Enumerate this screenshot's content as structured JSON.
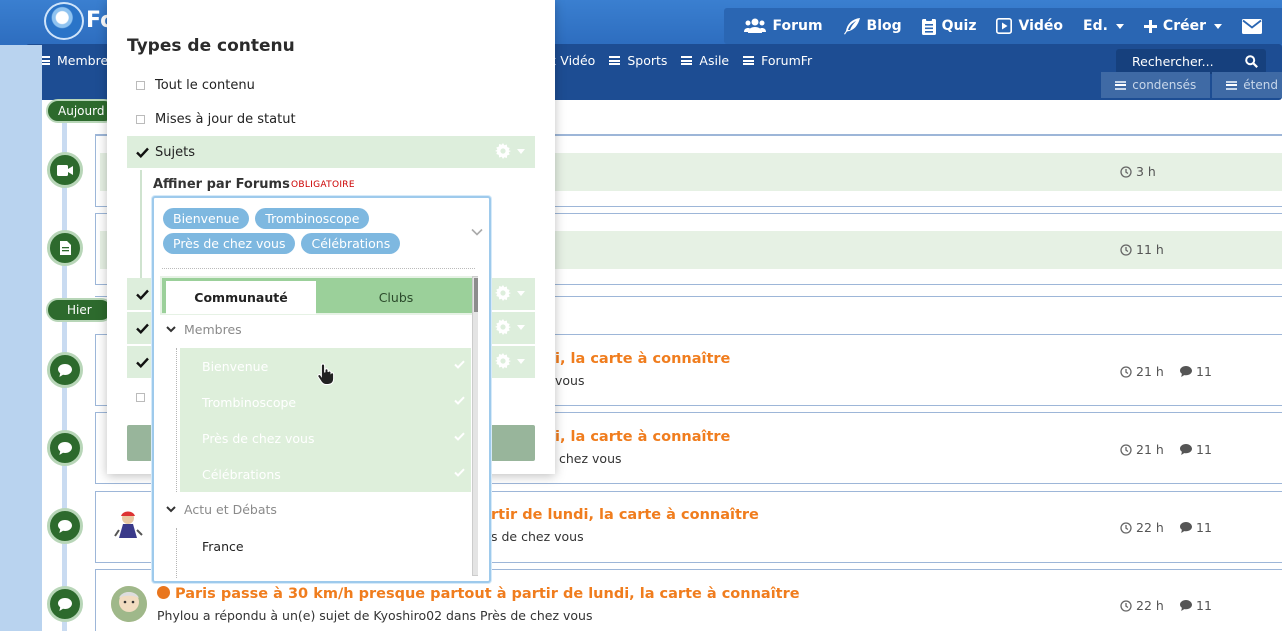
{
  "topbar": {
    "logo_text": "Fo",
    "nav": [
      {
        "label": "Forum",
        "icon": "users-icon"
      },
      {
        "label": "Blog",
        "icon": "feather-icon"
      },
      {
        "label": "Quiz",
        "icon": "clipboard-icon"
      },
      {
        "label": "Vidéo",
        "icon": "play-icon"
      },
      {
        "label": "Ed.",
        "icon": "none"
      },
      {
        "label": "Créer",
        "icon": "plus-icon"
      }
    ]
  },
  "subnav": {
    "first_item": "Membres",
    "items": [
      "ux Vidéo",
      "Sports",
      "Asile",
      "ForumFr"
    ],
    "search_placeholder": "Rechercher...",
    "view_condensed": "condensés",
    "view_expanded": "étend"
  },
  "timeline": {
    "today_label": "Aujourd",
    "yesterday_label": "Hier"
  },
  "stream": {
    "rows": [
      {
        "time": "3 h",
        "replies": ""
      },
      {
        "time": "11 h",
        "replies": ""
      },
      {
        "title_fragment": "i, la carte à connaître",
        "sub_fragment": "vous",
        "time": "21 h",
        "replies": "11"
      },
      {
        "title_fragment": "i, la carte à connaître",
        "sub_fragment": "chez vous",
        "time": "21 h",
        "replies": "11"
      },
      {
        "title_fragment": "rtir de lundi, la carte à connaître",
        "sub_fragment": "s de chez vous",
        "time": "22 h",
        "replies": "11"
      },
      {
        "title": "Paris passe à 30 km/h presque partout à partir de lundi, la carte à connaître",
        "sub": "Phylou a répondu à un(e) sujet de Kyoshiro02 dans Près de chez vous",
        "time": "22 h",
        "replies": "11"
      }
    ]
  },
  "modal": {
    "title": "Types de contenu",
    "options": {
      "all": "Tout le contenu",
      "status": "Mises à jour de statut",
      "topics": "Sujets"
    },
    "refine_label": "Affiner par Forums",
    "required_label": "OBLIGATOIRE"
  },
  "multiselect": {
    "tokens": [
      "Bienvenue",
      "Trombinoscope",
      "Près de chez vous",
      "Célébrations"
    ],
    "tabs": {
      "community": "Communauté",
      "clubs": "Clubs"
    },
    "groups": {
      "members": "Membres",
      "actu": "Actu et Débats"
    },
    "members_items": [
      "Bienvenue",
      "Trombinoscope",
      "Près de chez vous",
      "Célébrations"
    ],
    "actu_items": [
      "France"
    ]
  },
  "colors": {
    "header_blue": "#2c6bbd",
    "subnav_blue": "#1d4d93",
    "timeline_green": "#2d6a2d",
    "title_orange": "#f07d1e",
    "selected_green": "#ddeedc",
    "token_blue": "#7eb8e0"
  }
}
